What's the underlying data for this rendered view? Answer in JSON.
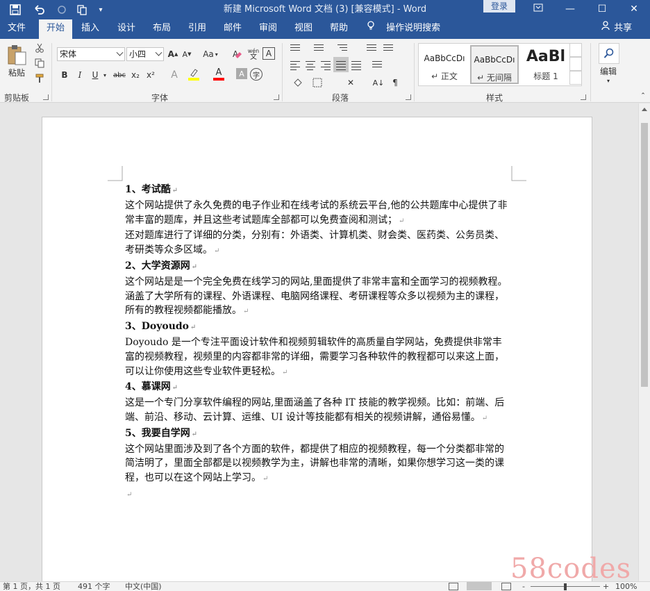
{
  "titlebar": {
    "title": "新建 Microsoft Word 文档 (3) [兼容模式]  -  Word",
    "login": "登录",
    "save_icon": "save-icon",
    "undo_icon": "undo-icon",
    "redo_icon": "redo-icon"
  },
  "tabs": [
    "文件",
    "开始",
    "插入",
    "设计",
    "布局",
    "引用",
    "邮件",
    "审阅",
    "视图",
    "帮助"
  ],
  "active_tab": "开始",
  "tell_me": "操作说明搜索",
  "share": "共享",
  "ribbon": {
    "clipboard": {
      "paste": "粘贴",
      "label": "剪贴板"
    },
    "font": {
      "name": "宋体",
      "size": "小四",
      "label": "字体",
      "aa": "Aa",
      "wen": "wén",
      "bold": "B",
      "italic": "I",
      "underline": "U",
      "strike": "abc",
      "sub": "x₂",
      "sup": "x²"
    },
    "paragraph": {
      "label": "段落"
    },
    "styles": {
      "label": "样式",
      "items": [
        {
          "sample": "AaBbCcDı",
          "name": "↵ 正文"
        },
        {
          "sample": "AaBbCcDı",
          "name": "↵ 无间隔"
        },
        {
          "sample": "AaBl",
          "name": "标题 1"
        }
      ]
    },
    "editing": {
      "label": "编辑"
    }
  },
  "document": {
    "paragraphs": [
      {
        "heading": true,
        "text": "1、考试酷"
      },
      {
        "heading": false,
        "text": "这个网站提供了永久免费的电子作业和在线考试的系统云平台,他的公共题库中心提供了非常丰富的题库，并且这些考试题库全部都可以免费查阅和测试；"
      },
      {
        "heading": false,
        "text": "还对题库进行了详细的分类，分别有：外语类、计算机类、财会类、医药类、公务员类、考研类等众多区域。"
      },
      {
        "heading": true,
        "text": "2、大学资源网"
      },
      {
        "heading": false,
        "text": "这个网站是是一个完全免费在线学习的网站,里面提供了非常丰富和全面学习的视频教程。涵盖了大学所有的课程、外语课程、电脑网络课程、考研课程等众多以视频为主的课程，所有的教程视频都能播放。"
      },
      {
        "heading": true,
        "text": "3、Doyoudo"
      },
      {
        "heading": false,
        "text": "Doyoudo 是一个专注平面设计软件和视频剪辑软件的高质量自学网站，免费提供非常丰富的视频教程，视频里的内容都非常的详细，需要学习各种软件的教程都可以来这上面，可以让你使用这些专业软件更轻松。"
      },
      {
        "heading": true,
        "text": "4、慕课网"
      },
      {
        "heading": false,
        "text": "这是一个专门分享软件编程的网站,里面涵盖了各种 IT 技能的教学视频。比如：前端、后端、前沿、移动、云计算、运维、UI 设计等技能都有相关的视频讲解，通俗易懂。"
      },
      {
        "heading": true,
        "text": "5、我要自学网"
      },
      {
        "heading": false,
        "text": "这个网站里面涉及到了各个方面的软件，都提供了相应的视频教程，每一个分类都非常的简洁明了，里面全部都是以视频教学为主，讲解也非常的清晰，如果你想学习这一类的课程，也可以在这个网站上学习。"
      },
      {
        "heading": false,
        "text": ""
      }
    ],
    "para_mark": "↵"
  },
  "statusbar": {
    "page": "第 1 页，共 1 页",
    "words": "491 个字",
    "language": "中文(中国)",
    "zoom": "100%",
    "minus": "-",
    "plus": "+"
  },
  "watermark": "58codes",
  "colors": {
    "titlebar": "#2b579a",
    "highlight": "#ffff00",
    "font_color": "#ff0000"
  }
}
